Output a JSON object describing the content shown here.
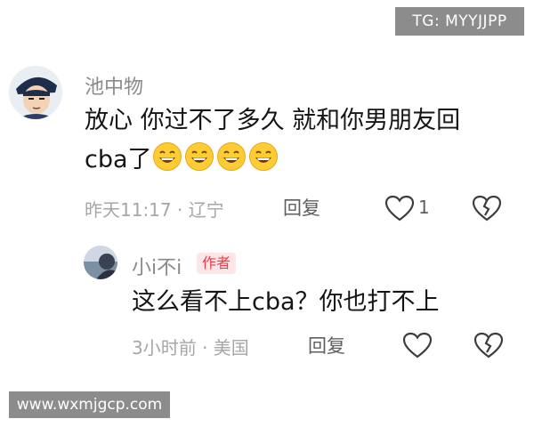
{
  "watermark_top": "TG: MYYJJPP",
  "watermark_bottom": "www.wxmjgcp.com",
  "comment": {
    "username": "池中物",
    "text_line1": "放心 你过不了多久 就和你男朋友回",
    "text_line2": "cba了",
    "emoji": [
      "grinning-face-icon",
      "grinning-face-icon",
      "grinning-face-icon",
      "grinning-face-icon"
    ],
    "meta": "昨天11:17 · 辽宁",
    "reply_label": "回复",
    "like_count": "1"
  },
  "reply": {
    "username": "小i不i",
    "author_badge": "作者",
    "text": "这么看不上cba？你也打不上",
    "meta": "3小时前 · 美国",
    "reply_label": "回复"
  }
}
